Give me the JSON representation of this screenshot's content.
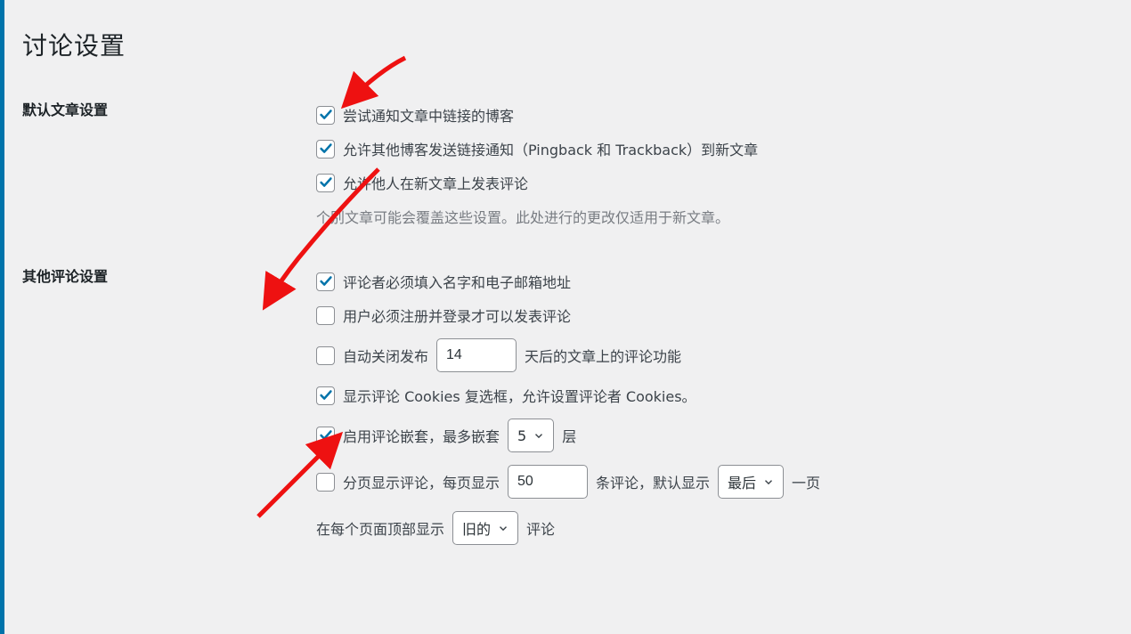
{
  "page": {
    "title": "讨论设置"
  },
  "sections": {
    "default_article": {
      "heading": "默认文章设置",
      "opt1": {
        "label": "尝试通知文章中链接的博客",
        "checked": true
      },
      "opt2": {
        "label": "允许其他博客发送链接通知（Pingback 和 Trackback）到新文章",
        "checked": true
      },
      "opt3": {
        "label": "允许他人在新文章上发表评论",
        "checked": true
      },
      "note": "个别文章可能会覆盖这些设置。此处进行的更改仅适用于新文章。"
    },
    "other_comments": {
      "heading": "其他评论设置",
      "opt1": {
        "label": "评论者必须填入名字和电子邮箱地址",
        "checked": true
      },
      "opt2": {
        "label": "用户必须注册并登录才可以发表评论",
        "checked": false
      },
      "opt3": {
        "prefix": "自动关闭发布",
        "days_value": "14",
        "suffix": "天后的文章上的评论功能",
        "checked": false
      },
      "opt4": {
        "label": "显示评论 Cookies 复选框，允许设置评论者 Cookies。",
        "checked": true
      },
      "opt5": {
        "prefix": "启用评论嵌套，最多嵌套",
        "levels_value": "5",
        "suffix": "层",
        "checked": true
      },
      "opt6": {
        "prefix": "分页显示评论，每页显示",
        "per_page_value": "50",
        "mid": "条评论，默认显示",
        "default_page_value": "最后",
        "suffix": "一页",
        "checked": false
      },
      "opt7": {
        "prefix": "在每个页面顶部显示",
        "order_value": "旧的",
        "suffix": "评论"
      }
    }
  }
}
